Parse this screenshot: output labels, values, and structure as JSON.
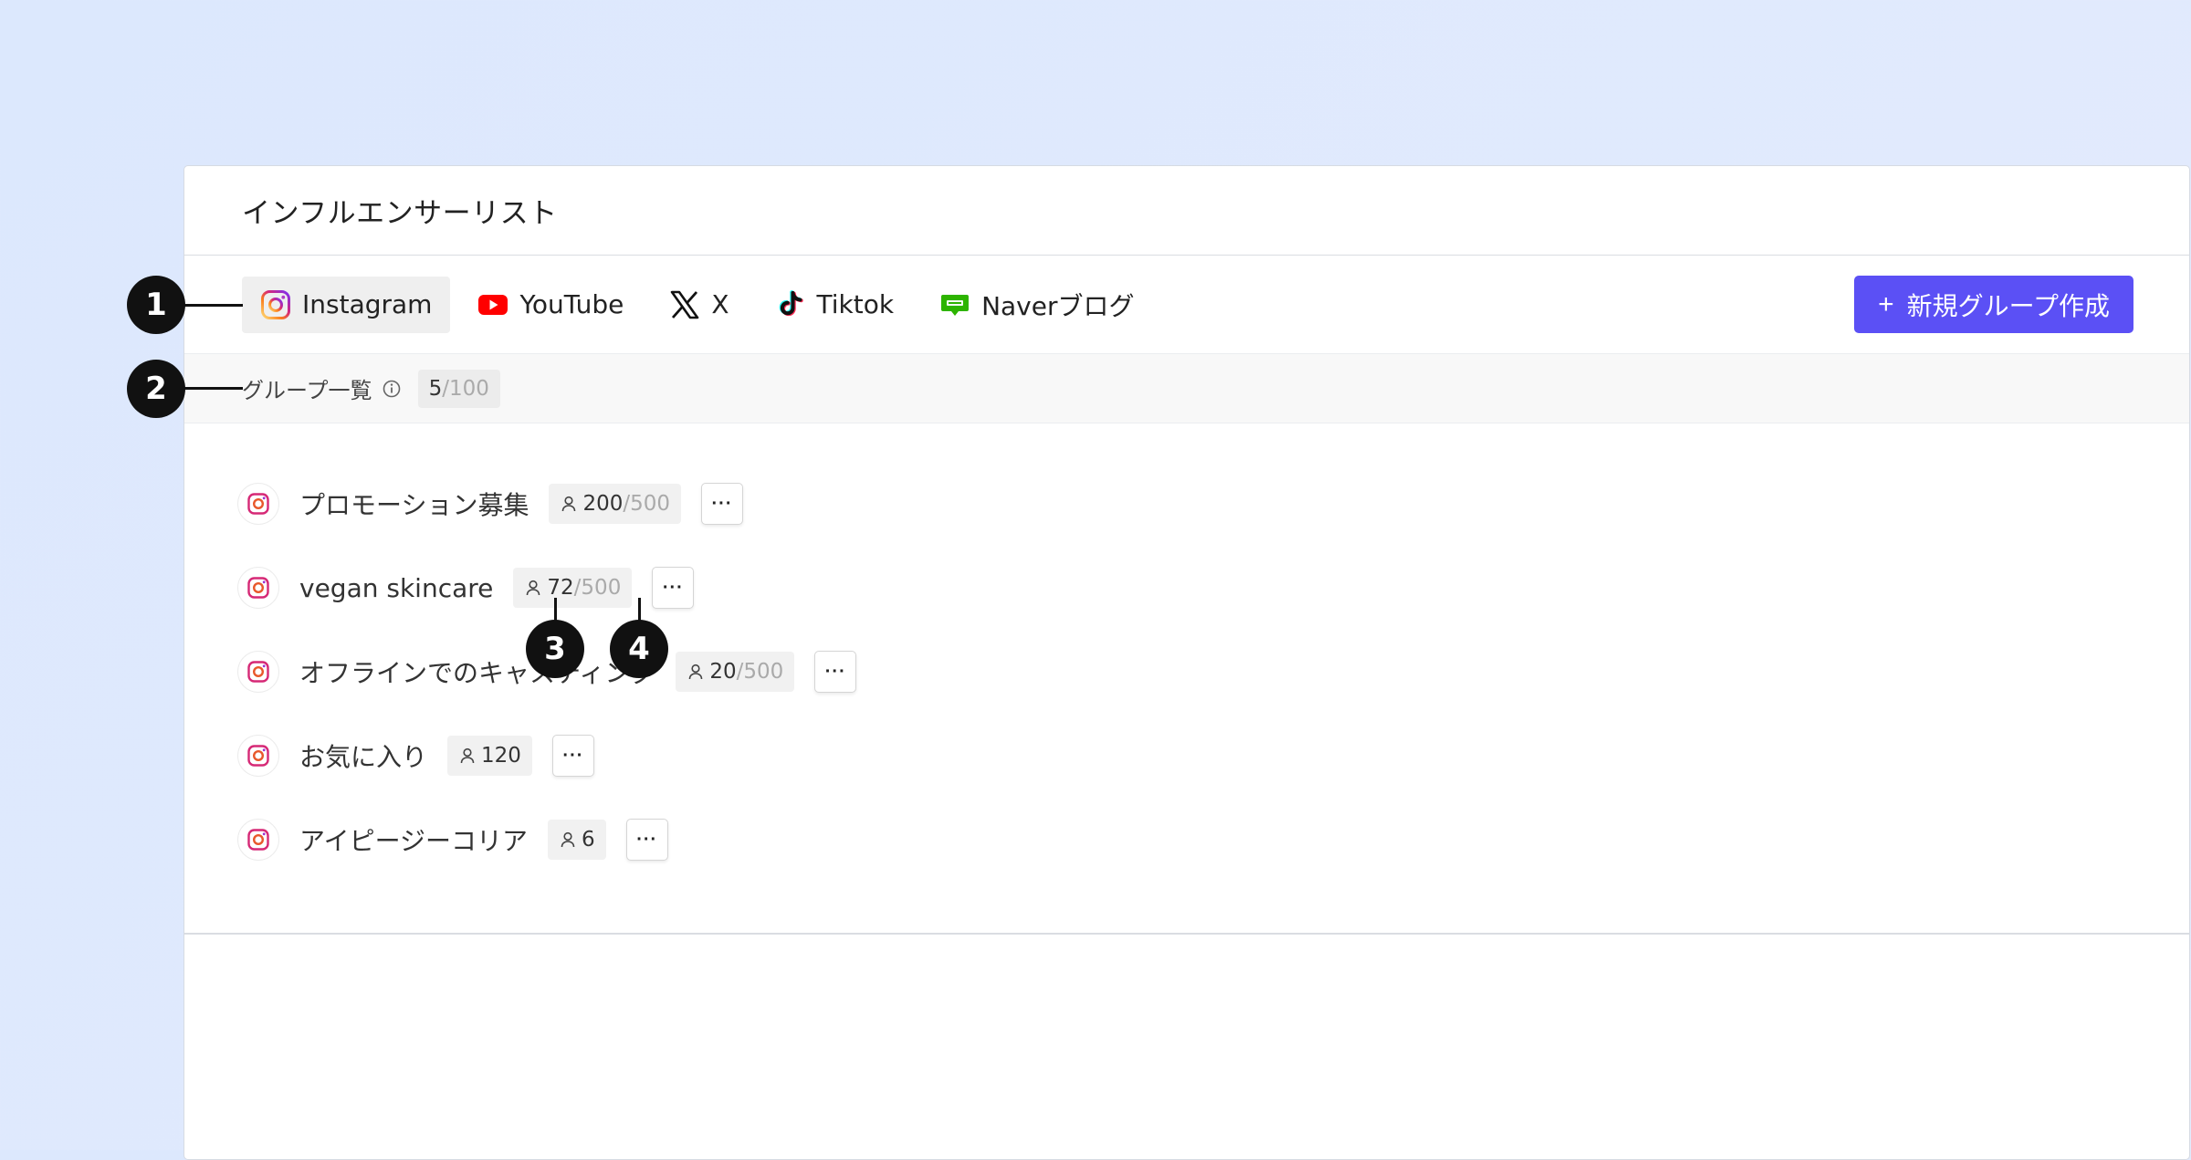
{
  "panel": {
    "title": "インフルエンサーリスト"
  },
  "tabs": [
    {
      "label": "Instagram",
      "icon": "instagram-icon",
      "active": true
    },
    {
      "label": "YouTube",
      "icon": "youtube-icon",
      "active": false
    },
    {
      "label": "X",
      "icon": "x-icon",
      "active": false
    },
    {
      "label": "Tiktok",
      "icon": "tiktok-icon",
      "active": false
    },
    {
      "label": "Naverブログ",
      "icon": "naver-blog-icon",
      "active": false
    }
  ],
  "new_group_button": {
    "plus": "+",
    "label": "新規グループ作成"
  },
  "group_header": {
    "label": "グループ一覧",
    "count": "5",
    "max": "/100"
  },
  "groups": [
    {
      "name": "プロモーション募集",
      "members": "200",
      "max": "/500"
    },
    {
      "name": "vegan skincare",
      "members": "72",
      "max": "/500"
    },
    {
      "name": "オフラインでのキャスティング",
      "members": "20",
      "max": "/500"
    },
    {
      "name": "お気に入り",
      "members": "120",
      "max": ""
    },
    {
      "name": "アイピージーコリア",
      "members": "6",
      "max": ""
    }
  ],
  "more_label": "···",
  "markers": [
    "1",
    "2",
    "3",
    "4"
  ],
  "colors": {
    "accent": "#5b50f5",
    "background": "#dce8fd",
    "youtube": "#ff0000",
    "naver": "#2db400"
  }
}
